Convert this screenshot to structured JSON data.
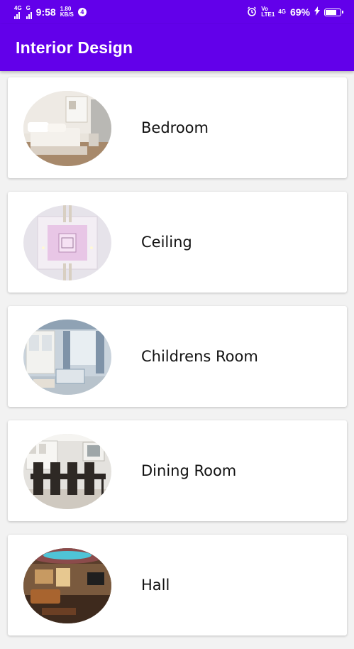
{
  "status_bar": {
    "network_left": "4G",
    "network_right": "G",
    "time": "9:58",
    "data_speed_value": "1.80",
    "data_speed_unit": "KB/S",
    "notification_count": "4",
    "volte_label": "Vo LTE1",
    "network_type": "4G",
    "battery_percent": "69%",
    "battery_level": 0.69
  },
  "app_bar": {
    "title": "Interior Design"
  },
  "categories": [
    {
      "label": "Bedroom",
      "image_icon": "bedroom-photo"
    },
    {
      "label": "Ceiling",
      "image_icon": "ceiling-photo"
    },
    {
      "label": "Childrens Room",
      "image_icon": "childrens-room-photo"
    },
    {
      "label": "Dining Room",
      "image_icon": "dining-room-photo"
    },
    {
      "label": "Hall",
      "image_icon": "hall-photo"
    }
  ]
}
